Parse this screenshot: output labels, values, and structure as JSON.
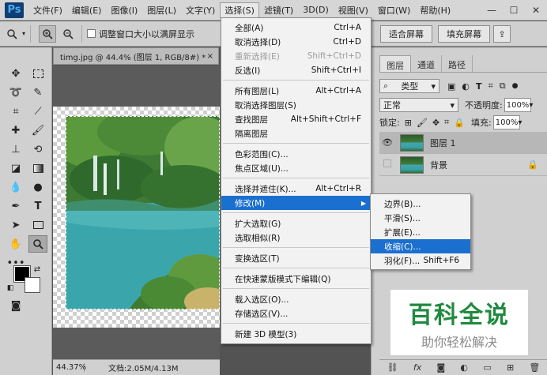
{
  "app": {
    "logo": "Ps"
  },
  "menubar": {
    "items": [
      "文件(F)",
      "编辑(E)",
      "图像(I)",
      "图层(L)",
      "文字(Y)",
      "选择(S)",
      "滤镜(T)",
      "3D(D)",
      "视图(V)",
      "窗口(W)",
      "帮助(H)"
    ],
    "active": "选择(S)"
  },
  "window_controls": {
    "minimize": "—",
    "maximize": "☐",
    "close": "✕"
  },
  "optionsbar": {
    "zoom_tool_icon": "zoom-icon",
    "resize_window_label": "调整窗口大小以满屏显示",
    "fit_screen": "适合屏幕",
    "fill_screen": "填充屏幕"
  },
  "document": {
    "tab_title": "timg.jpg @ 44.4% (图层 1, RGB/8#) *",
    "tab_close": "×",
    "zoom_status": "44.37%",
    "doc_status": "文档:2.05M/4.13M"
  },
  "select_menu": {
    "items": [
      {
        "label": "全部(A)",
        "shortcut": "Ctrl+A",
        "disabled": false
      },
      {
        "label": "取消选择(D)",
        "shortcut": "Ctrl+D",
        "disabled": false
      },
      {
        "label": "重新选择(E)",
        "shortcut": "Shift+Ctrl+D",
        "disabled": true
      },
      {
        "label": "反选(I)",
        "shortcut": "Shift+Ctrl+I",
        "disabled": false
      },
      {
        "label": "所有图层(L)",
        "shortcut": "Alt+Ctrl+A",
        "disabled": false
      },
      {
        "label": "取消选择图层(S)",
        "shortcut": "",
        "disabled": false
      },
      {
        "label": "查找图层",
        "shortcut": "Alt+Shift+Ctrl+F",
        "disabled": false
      },
      {
        "label": "隔离图层",
        "shortcut": "",
        "disabled": false
      },
      {
        "label": "色彩范围(C)...",
        "shortcut": "",
        "disabled": false
      },
      {
        "label": "焦点区域(U)...",
        "shortcut": "",
        "disabled": false
      },
      {
        "label": "选择并遮住(K)...",
        "shortcut": "Alt+Ctrl+R",
        "disabled": false
      },
      {
        "label": "修改(M)",
        "shortcut": "",
        "disabled": false,
        "highlighted": true
      },
      {
        "label": "扩大选取(G)",
        "shortcut": "",
        "disabled": false
      },
      {
        "label": "选取相似(R)",
        "shortcut": "",
        "disabled": false
      },
      {
        "label": "变换选区(T)",
        "shortcut": "",
        "disabled": false
      },
      {
        "label": "在快速蒙版模式下编辑(Q)",
        "shortcut": "",
        "disabled": false
      },
      {
        "label": "载入选区(O)...",
        "shortcut": "",
        "disabled": false
      },
      {
        "label": "存储选区(V)...",
        "shortcut": "",
        "disabled": false
      },
      {
        "label": "新建 3D 模型(3)",
        "shortcut": "",
        "disabled": false
      }
    ]
  },
  "modify_submenu": {
    "items": [
      {
        "label": "边界(B)...",
        "shortcut": ""
      },
      {
        "label": "平滑(S)...",
        "shortcut": ""
      },
      {
        "label": "扩展(E)...",
        "shortcut": ""
      },
      {
        "label": "收缩(C)...",
        "shortcut": "",
        "highlighted": true
      },
      {
        "label": "羽化(F)...",
        "shortcut": "Shift+F6"
      }
    ]
  },
  "layers_panel": {
    "tabs": [
      "图层",
      "通道",
      "路径"
    ],
    "active_tab": "图层",
    "filter_label": "类型",
    "blend_mode": "正常",
    "opacity_label": "不透明度:",
    "opacity_value": "100%",
    "lock_label": "锁定:",
    "fill_label": "填充:",
    "fill_value": "100%",
    "layers": [
      {
        "name": "图层 1",
        "visible": true,
        "selected": true
      },
      {
        "name": "背景",
        "visible": false,
        "selected": false,
        "locked": true
      }
    ],
    "bottom_icons": [
      "link-icon",
      "fx-icon",
      "mask-icon",
      "adjustment-icon",
      "group-icon",
      "new-layer-icon",
      "trash-icon"
    ]
  },
  "watermark": {
    "title": "百科全说",
    "subtitle": "助你轻松解决"
  },
  "colors": {
    "menu_highlight": "#1b6fcf",
    "water": "#3aa6ac",
    "watermark_green": "#1f8a3e"
  }
}
